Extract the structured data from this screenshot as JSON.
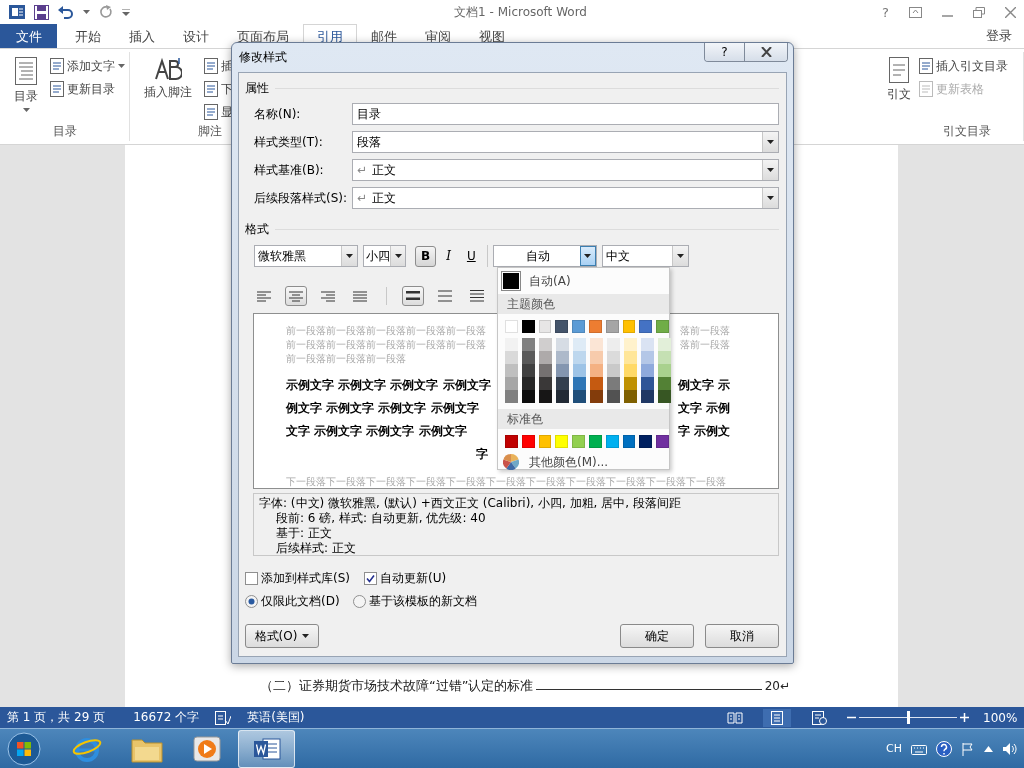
{
  "titlebar": {
    "title": "文档1 - Microsoft Word",
    "help": "?"
  },
  "ribbon_tabs": [
    {
      "label": "文件",
      "kind": "file",
      "selected": false
    },
    {
      "label": "开始",
      "kind": "tab",
      "selected": false
    },
    {
      "label": "插入",
      "kind": "tab",
      "selected": false
    },
    {
      "label": "设计",
      "kind": "tab",
      "selected": false
    },
    {
      "label": "页面布局",
      "kind": "tab",
      "selected": false
    },
    {
      "label": "引用",
      "kind": "tab",
      "selected": true
    },
    {
      "label": "邮件",
      "kind": "tab",
      "selected": false
    },
    {
      "label": "审阅",
      "kind": "tab",
      "selected": false
    },
    {
      "label": "视图",
      "kind": "tab",
      "selected": false
    }
  ],
  "account": "登录",
  "ribbon_groups": [
    {
      "title": "目录",
      "large_button": {
        "label": "目录",
        "has_menu": true
      },
      "small_buttons": [
        {
          "label": "添加文字",
          "has_menu": true,
          "disabled": false
        },
        {
          "label": "更新目录",
          "has_menu": false,
          "disabled": false
        }
      ]
    },
    {
      "title": "脚注",
      "large_button": {
        "label": "插入脚注",
        "has_menu": false
      },
      "small_buttons": [
        {
          "label": "插",
          "has_menu": false,
          "disabled": false
        },
        {
          "label": "下",
          "has_menu": false,
          "disabled": false
        },
        {
          "label": "显",
          "has_menu": false,
          "disabled": false
        }
      ]
    },
    {
      "large_button": {
        "label": "引文",
        "has_menu": false
      }
    },
    {
      "title": "引文目录",
      "small_buttons": [
        {
          "label": "插入引文目录",
          "has_menu": false,
          "disabled": false
        },
        {
          "label": "更新表格",
          "has_menu": false,
          "disabled": true
        }
      ]
    }
  ],
  "document": {
    "toc_lines": [
      {
        "text": "（二）证券期货市场技术故障“过错”认定的标准",
        "page": "20",
        "mark": "↵"
      }
    ]
  },
  "dialog": {
    "title": "修改样式",
    "help": "?",
    "properties_heading": "属性",
    "fields": [
      {
        "label": "名称(N):",
        "value": "目录",
        "kind": "text"
      },
      {
        "label": "样式类型(T):",
        "value": "段落",
        "kind": "dropdown"
      },
      {
        "label": "样式基准(B):",
        "mark": "↵",
        "value": "正文",
        "kind": "dropdown"
      },
      {
        "label": "后续段落样式(S):",
        "mark": "↵",
        "value": "正文",
        "kind": "dropdown"
      }
    ],
    "format_heading": "格式",
    "font": "微软雅黑",
    "size": "小四",
    "bold": {
      "label": "B",
      "on": true
    },
    "italic": {
      "label": "I",
      "on": false
    },
    "underline": {
      "label": "U",
      "on": false
    },
    "font_color": {
      "value": "自动",
      "open": true
    },
    "script": "中文",
    "alignment": [
      {
        "kind": "left",
        "selected": false
      },
      {
        "kind": "center",
        "selected": true
      },
      {
        "kind": "right",
        "selected": false
      },
      {
        "kind": "justify",
        "selected": false
      }
    ],
    "line_spacing": [
      {
        "kind": "single",
        "selected": true
      },
      {
        "kind": "one_half",
        "selected": false
      },
      {
        "kind": "double",
        "selected": false
      }
    ],
    "preview": {
      "previous_lines": [
        {
          "left": "前一段落前一段落前一段落前一段落前一段落",
          "right": "落前一段落"
        },
        {
          "left": "前一段落前一段落前一段落前一段落前一段落",
          "right": "落前一段落"
        },
        {
          "left": "前一段落前一段落前一段落"
        }
      ],
      "sample_lines": [
        {
          "left": "示例文字 示例文字 示例文字 示例文字",
          "right": "例文字 示"
        },
        {
          "left": "例文字 示例文字 示例文字 示例文字",
          "right": "文字 示例"
        },
        {
          "left": "文字 示例文字 示例文字 示例文字",
          "right": "字 示例文"
        },
        {
          "left": "字"
        }
      ],
      "next_lines": [
        {
          "left": "下一段落下一段落下一段落下一段落下一段落下一段落下一段落下一段落下一段落下一段落下一段落"
        }
      ]
    },
    "description": [
      "字体: (中文) 微软雅黑, (默认) +西文正文 (Calibri), 小四, 加粗, 居中, 段落间距",
      "段前: 6 磅, 样式: 自动更新, 优先级: 40",
      "基于: 正文",
      "后续样式: 正文"
    ],
    "checkboxes": [
      {
        "label": "添加到样式库(S)",
        "checked": false
      },
      {
        "label": "自动更新(U)",
        "checked": true
      }
    ],
    "radios": [
      {
        "label": "仅限此文档(D)",
        "selected": true
      },
      {
        "label": "基于该模板的新文档",
        "selected": false
      }
    ],
    "format_button": "格式(O)",
    "buttons": [
      "确定",
      "取消"
    ]
  },
  "color_menu": {
    "automatic": {
      "label": "自动(A)",
      "color": "#000000"
    },
    "theme_heading": "主题颜色",
    "theme_colors": [
      {
        "color": "#ffffff",
        "shades": [
          {
            "color": "#f2f2f2"
          },
          {
            "color": "#d9d9d9"
          },
          {
            "color": "#bfbfbf"
          },
          {
            "color": "#a6a6a6"
          },
          {
            "color": "#808080"
          }
        ]
      },
      {
        "color": "#000000",
        "shades": [
          {
            "color": "#808080"
          },
          {
            "color": "#595959"
          },
          {
            "color": "#404040"
          },
          {
            "color": "#262626"
          },
          {
            "color": "#0d0d0d"
          }
        ]
      },
      {
        "color": "#e7e6e6",
        "shades": [
          {
            "color": "#d0cece"
          },
          {
            "color": "#aeaaaa"
          },
          {
            "color": "#757171"
          },
          {
            "color": "#3a3838"
          },
          {
            "color": "#171616"
          }
        ]
      },
      {
        "color": "#44546a",
        "shades": [
          {
            "color": "#d6dce4"
          },
          {
            "color": "#adb9ca"
          },
          {
            "color": "#8496b0"
          },
          {
            "color": "#333f4f"
          },
          {
            "color": "#222a35"
          }
        ]
      },
      {
        "color": "#5b9bd5",
        "shades": [
          {
            "color": "#deebf6"
          },
          {
            "color": "#bdd7ee"
          },
          {
            "color": "#9dc3e6"
          },
          {
            "color": "#2e75b5"
          },
          {
            "color": "#1f4e79"
          }
        ]
      },
      {
        "color": "#ed7d31",
        "shades": [
          {
            "color": "#fbe5d5"
          },
          {
            "color": "#f7cbac"
          },
          {
            "color": "#f4b183"
          },
          {
            "color": "#c55a11"
          },
          {
            "color": "#833c0b"
          }
        ]
      },
      {
        "color": "#a5a5a5",
        "shades": [
          {
            "color": "#ededed"
          },
          {
            "color": "#dbdbdb"
          },
          {
            "color": "#c9c9c9"
          },
          {
            "color": "#7b7b7b"
          },
          {
            "color": "#525252"
          }
        ]
      },
      {
        "color": "#ffc000",
        "shades": [
          {
            "color": "#fff2cc"
          },
          {
            "color": "#ffe699"
          },
          {
            "color": "#ffd966"
          },
          {
            "color": "#bf9000"
          },
          {
            "color": "#7f6000"
          }
        ]
      },
      {
        "color": "#4472c4",
        "shades": [
          {
            "color": "#dae3f3"
          },
          {
            "color": "#b4c7e7"
          },
          {
            "color": "#8faadc"
          },
          {
            "color": "#2f5597"
          },
          {
            "color": "#203864"
          }
        ]
      },
      {
        "color": "#70ad47",
        "shades": [
          {
            "color": "#e2efd9"
          },
          {
            "color": "#c5e0b3"
          },
          {
            "color": "#a9d18e"
          },
          {
            "color": "#538135"
          },
          {
            "color": "#375623"
          }
        ]
      }
    ],
    "standard_heading": "标准色",
    "standard_colors": [
      {
        "color": "#c00000"
      },
      {
        "color": "#ff0000"
      },
      {
        "color": "#ffc000"
      },
      {
        "color": "#ffff00"
      },
      {
        "color": "#92d050"
      },
      {
        "color": "#00b050"
      },
      {
        "color": "#00b0f0"
      },
      {
        "color": "#0070c0"
      },
      {
        "color": "#002060"
      },
      {
        "color": "#7030a0"
      }
    ],
    "more_colors": "其他颜色(M)..."
  },
  "status_bar": {
    "page": "第 1 页，共 29 页",
    "words": "16672 个字",
    "language": "英语(美国)",
    "views": [
      {
        "kind": "read",
        "selected": false
      },
      {
        "kind": "print",
        "selected": true
      },
      {
        "kind": "web",
        "selected": false
      }
    ],
    "zoom": {
      "level": 0.5,
      "reading": "100%"
    }
  },
  "taskbar": {
    "apps": [
      {
        "kind": "browser",
        "active": false
      },
      {
        "kind": "folder",
        "active": false
      },
      {
        "kind": "media",
        "active": false
      },
      {
        "kind": "word",
        "active": true
      }
    ],
    "language": "CH"
  }
}
